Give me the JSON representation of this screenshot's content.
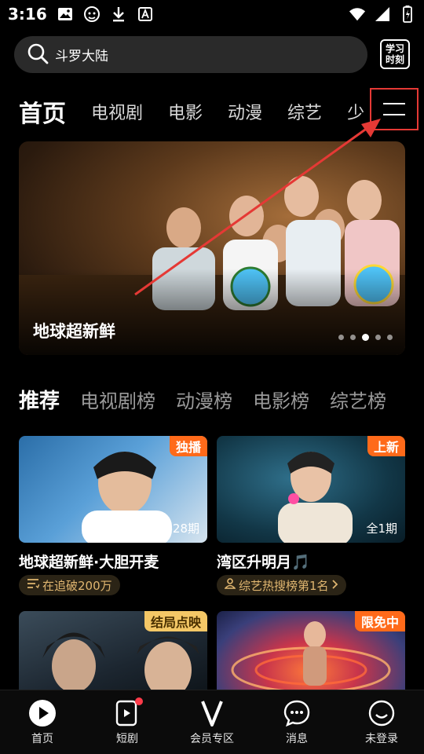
{
  "status_bar": {
    "time": "3:16",
    "left_icons": [
      "image-icon",
      "android-head-icon",
      "download-icon",
      "font-icon"
    ],
    "right_icons": [
      "wifi-icon",
      "signal-icon",
      "battery-icon"
    ]
  },
  "search": {
    "query": "斗罗大陆",
    "study_button": "学习时刻"
  },
  "channels": {
    "tabs": [
      "首页",
      "电视剧",
      "电影",
      "动漫",
      "综艺",
      "少"
    ],
    "active_index": 0
  },
  "banner": {
    "title": "地球超新鲜",
    "dot_count": 5,
    "active_dot": 2
  },
  "rank_tabs": {
    "tabs": [
      "推荐",
      "电视剧榜",
      "动漫榜",
      "电影榜",
      "综艺榜"
    ],
    "active_index": 0
  },
  "cards": [
    {
      "badge": "独播",
      "update": "更新至09-28期",
      "title": "地球超新鲜·大胆开麦",
      "pill": "在追破200万"
    },
    {
      "badge": "上新",
      "update": "全1期",
      "title": "湾区升明月🎵",
      "pill": "综艺热搜榜第1名"
    },
    {
      "badge": "结局点映"
    },
    {
      "badge": "限免中"
    }
  ],
  "bottom_nav": {
    "items": [
      "首页",
      "短剧",
      "会员专区",
      "消息",
      "未登录"
    ]
  },
  "colors": {
    "accent_orange": "#ff6a1a",
    "gold_badge": "#f4c766",
    "annotation_red": "#e53935",
    "pill_text": "#e0b670"
  }
}
